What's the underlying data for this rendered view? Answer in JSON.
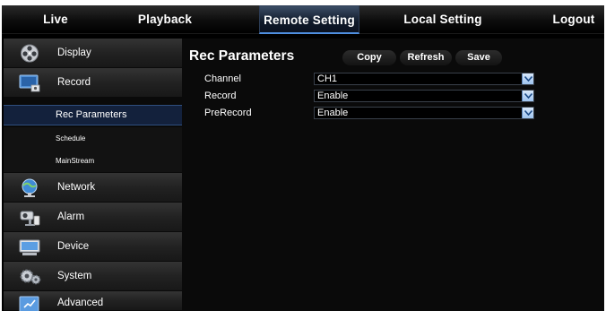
{
  "nav": {
    "items": [
      {
        "label": "Live"
      },
      {
        "label": "Playback"
      },
      {
        "label": "Remote Setting",
        "active": true
      },
      {
        "label": "Local Setting"
      },
      {
        "label": "Logout"
      }
    ]
  },
  "sidebar": {
    "items": [
      {
        "label": "Display",
        "icon": "display-icon"
      },
      {
        "label": "Record",
        "icon": "record-icon",
        "expanded": true,
        "children": [
          {
            "label": "Rec Parameters",
            "selected": true
          },
          {
            "label": "Schedule"
          },
          {
            "label": "MainStream"
          }
        ]
      },
      {
        "label": "Network",
        "icon": "network-icon"
      },
      {
        "label": "Alarm",
        "icon": "alarm-icon"
      },
      {
        "label": "Device",
        "icon": "device-icon"
      },
      {
        "label": "System",
        "icon": "system-icon"
      },
      {
        "label": "Advanced",
        "icon": "advanced-icon"
      }
    ]
  },
  "panel": {
    "title": "Rec Parameters",
    "buttons": {
      "copy": "Copy",
      "refresh": "Refresh",
      "save": "Save"
    },
    "fields": [
      {
        "label": "Channel",
        "value": "CH1"
      },
      {
        "label": "Record",
        "value": "Enable"
      },
      {
        "label": "PreRecord",
        "value": "Enable"
      }
    ]
  },
  "colors": {
    "accent": "#4f8fe0",
    "selected_row": "#13213c",
    "panel_bg": "#0a0a0a"
  }
}
